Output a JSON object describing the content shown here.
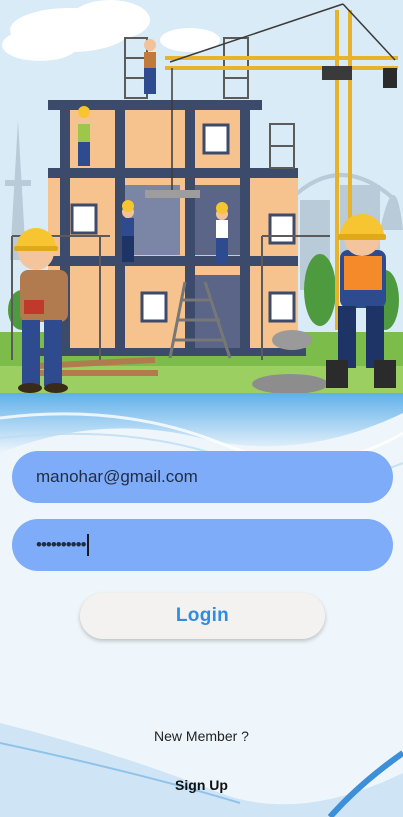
{
  "hero": {
    "icon": "construction-workers-illustration"
  },
  "login_form": {
    "email_value": "manohar@gmail.com",
    "password_masked": "••••••••••",
    "login_label": "Login"
  },
  "signup": {
    "prompt": "New Member ?",
    "link_label": "Sign Up"
  },
  "colors": {
    "field_fill": "#7facf8",
    "login_text": "#2f8de0",
    "button_fill": "#f4f2f1"
  }
}
